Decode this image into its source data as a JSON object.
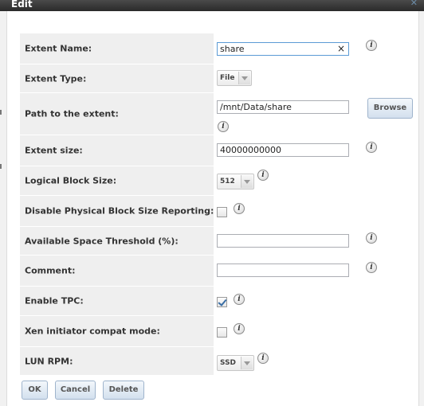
{
  "dialog": {
    "title": "Edit"
  },
  "fields": {
    "extent_name": {
      "label": "Extent Name:",
      "value": "share"
    },
    "extent_type": {
      "label": "Extent Type:",
      "value": "File"
    },
    "path": {
      "label": "Path to the extent:",
      "value": "/mnt/Data/share",
      "browse_label": "Browse"
    },
    "extent_size": {
      "label": "Extent size:",
      "value": "40000000000"
    },
    "logical_block_size": {
      "label": "Logical Block Size:",
      "value": "512"
    },
    "disable_physical": {
      "label": "Disable Physical Block Size Reporting:",
      "checked": false
    },
    "space_threshold": {
      "label": "Available Space Threshold (%):",
      "value": ""
    },
    "comment": {
      "label": "Comment:",
      "value": ""
    },
    "enable_tpc": {
      "label": "Enable TPC:",
      "checked": true
    },
    "xen_compat": {
      "label": "Xen initiator compat mode:",
      "checked": false
    },
    "lun_rpm": {
      "label": "LUN RPM:",
      "value": "SSD"
    }
  },
  "buttons": {
    "ok": "OK",
    "cancel": "Cancel",
    "delete": "Delete"
  },
  "icons": {
    "info": "i",
    "clear": "×",
    "close": "✕"
  }
}
